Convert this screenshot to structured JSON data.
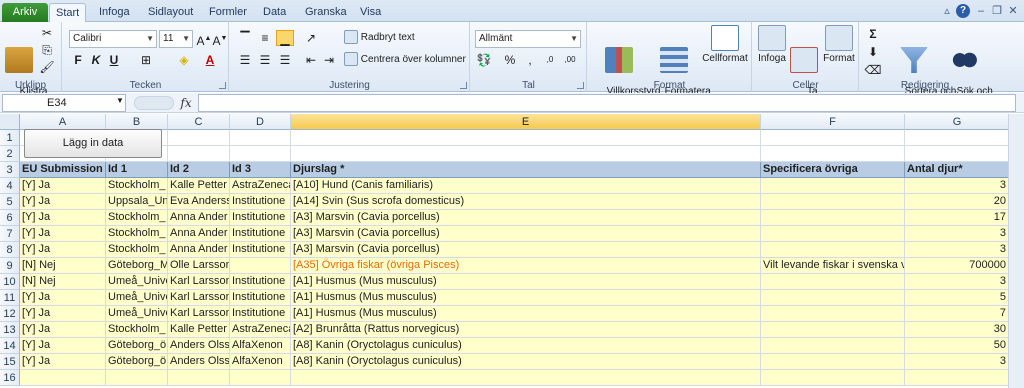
{
  "ribbon_tabs": [
    "Arkiv",
    "Start",
    "Infoga",
    "Sidlayout",
    "Formler",
    "Data",
    "Granska",
    "Visa"
  ],
  "active_tab": "Start",
  "clipboard": {
    "paste": "Klistra\nin",
    "label": "Urklipp"
  },
  "font": {
    "name": "Calibri",
    "size": "11",
    "label": "Tecken"
  },
  "alignment": {
    "wrap": "Radbryt text",
    "merge": "Centrera över kolumner",
    "label": "Justering"
  },
  "number": {
    "format": "Allmänt",
    "label": "Tal"
  },
  "styles": {
    "cond": "Villkorsstyrd\nformatering",
    "table": "Formatera\nsom tabell",
    "cell": "Cellformat",
    "label": "Format"
  },
  "cells": {
    "insert": "Infoga",
    "delete": "Ta\nbort",
    "format": "Format",
    "label": "Celler"
  },
  "editing": {
    "sort": "Sortera och\nfiltrera",
    "find": "Sök och\nmarkera",
    "label": "Redigering"
  },
  "name_box": "E34",
  "formula": "",
  "columns": [
    "A",
    "B",
    "C",
    "D",
    "E",
    "F",
    "G"
  ],
  "selected_column": "E",
  "button_lagg": "Lägg in data",
  "header_row": [
    "EU Submission *",
    "Id 1",
    "Id 2",
    "Id 3",
    "Djurslag *",
    "Specificera övriga",
    "Antal djur*"
  ],
  "row_numbers": [
    "1",
    "2",
    "3",
    "4",
    "5",
    "6",
    "7",
    "8",
    "9",
    "10",
    "11",
    "12",
    "13",
    "14",
    "15",
    "16"
  ],
  "rows": [
    [
      "[Y] Ja",
      "Stockholm_",
      "Kalle Petter",
      "AstraZeneca",
      "[A10] Hund (Canis familiaris)",
      "",
      "3"
    ],
    [
      "[Y] Ja",
      "Uppsala_Un",
      "Eva Anderss",
      "Institutione",
      "[A14] Svin (Sus scrofa domesticus)",
      "",
      "20"
    ],
    [
      "[Y] Ja",
      "Stockholm_",
      "Anna Ander",
      "Institutione",
      "[A3] Marsvin (Cavia porcellus)",
      "",
      "17"
    ],
    [
      "[Y] Ja",
      "Stockholm_",
      "Anna Ander",
      "Institutione",
      "[A3] Marsvin (Cavia porcellus)",
      "",
      "3"
    ],
    [
      "[Y] Ja",
      "Stockholm_",
      "Anna Ander",
      "Institutione",
      "[A3] Marsvin (Cavia porcellus)",
      "",
      "3"
    ],
    [
      "[N] Nej",
      "Göteborg_M",
      "Olle Larsson",
      "",
      "[A35] Övriga fiskar (övriga Pisces)",
      "Vilt levande fiskar i svenska v",
      "700000"
    ],
    [
      "[N] Nej",
      "Umeå_Unive",
      "Karl Larsson",
      "Institutione",
      "[A1] Husmus (Mus musculus)",
      "",
      "3"
    ],
    [
      "[Y] Ja",
      "Umeå_Unive",
      "Karl Larsson",
      "Institutione",
      "[A1] Husmus (Mus musculus)",
      "",
      "5"
    ],
    [
      "[Y] Ja",
      "Umeå_Unive",
      "Karl Larsson",
      "Institutione",
      "[A1] Husmus (Mus musculus)",
      "",
      "7"
    ],
    [
      "[Y] Ja",
      "Stockholm_",
      "Kalle Petter",
      "AstraZeneca",
      "[A2] Brunråtta (Rattus norvegicus)",
      "",
      "30"
    ],
    [
      "[Y] Ja",
      "Göteborg_ö",
      "Anders Olss",
      "AlfaXenon",
      "[A8] Kanin (Oryctolagus cuniculus)",
      "",
      "50"
    ],
    [
      "[Y] Ja",
      "Göteborg_ö",
      "Anders Olss",
      "AlfaXenon",
      "[A8] Kanin (Oryctolagus cuniculus)",
      "",
      "3"
    ]
  ]
}
